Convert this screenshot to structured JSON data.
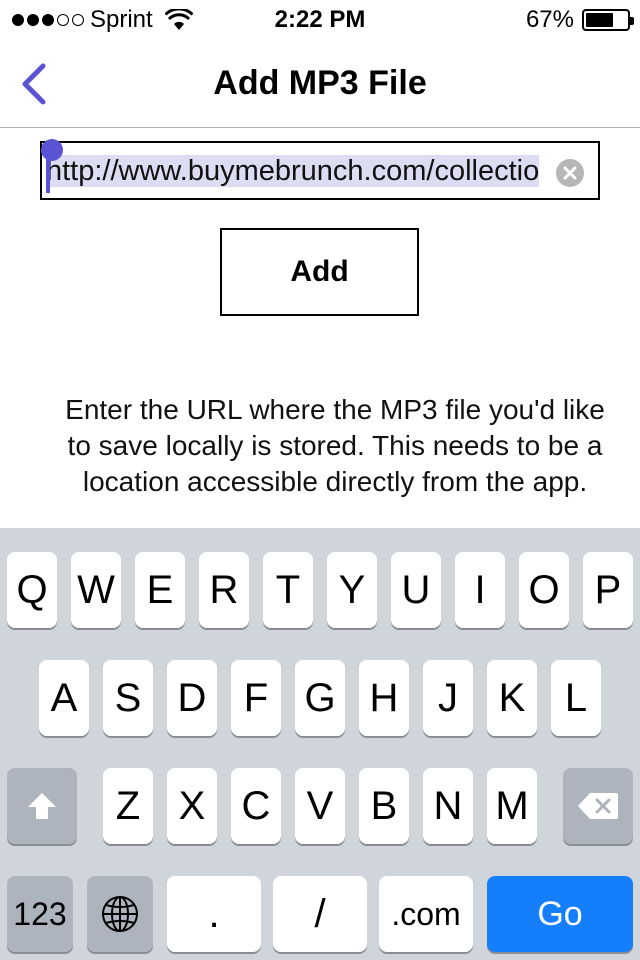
{
  "status_bar": {
    "carrier": "Sprint",
    "time": "2:22 PM",
    "battery": "67%",
    "battery_level": 0.67,
    "signal_bars_filled": 3,
    "signal_bars_total": 5,
    "icons": [
      "signal-dots",
      "wifi-icon",
      "battery-icon"
    ]
  },
  "nav": {
    "title": "Add MP3 File",
    "back_icon": "chevron-left-icon",
    "accent_color": "#5a54d4"
  },
  "url_field": {
    "value": "http://www.buymebrunch.com/collectio",
    "clear_icon": "clear-icon"
  },
  "add_button": {
    "label": "Add"
  },
  "instructions": {
    "text": "Enter the URL where the MP3 file you'd like to save locally is stored.  This needs to be a location accessible directly from the app."
  },
  "keyboard": {
    "row1": [
      "Q",
      "W",
      "E",
      "R",
      "T",
      "Y",
      "U",
      "I",
      "O",
      "P"
    ],
    "row2": [
      "A",
      "S",
      "D",
      "F",
      "G",
      "H",
      "J",
      "K",
      "L"
    ],
    "row3": [
      "Z",
      "X",
      "C",
      "V",
      "B",
      "N",
      "M"
    ],
    "numbers_label": "123",
    "period_label": ".",
    "slash_label": "/",
    "dotcom_label": ".com",
    "go_label": "Go",
    "go_color": "#157efb",
    "icons": [
      "shift-icon",
      "delete-icon",
      "globe-icon"
    ]
  }
}
